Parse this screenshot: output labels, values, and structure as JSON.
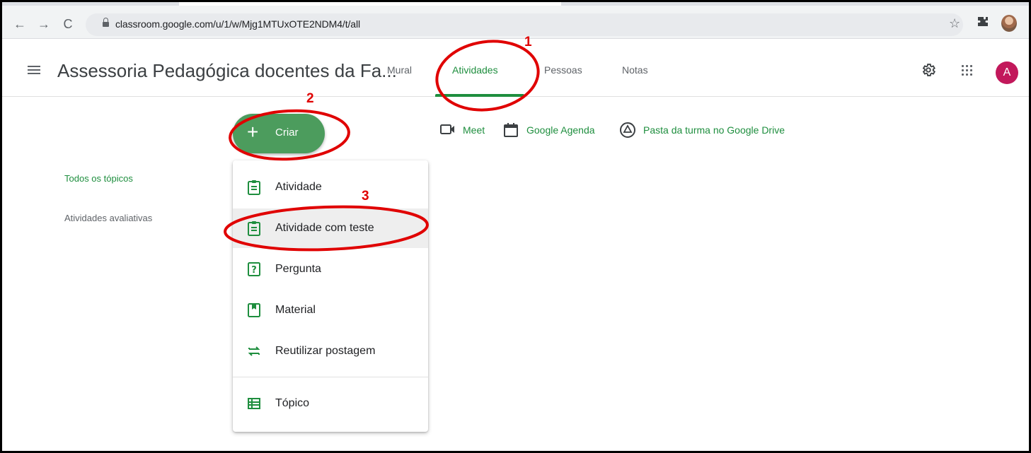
{
  "browser": {
    "url": "classroom.google.com/u/1/w/Mjg1MTUxOTE2NDM4/t/all",
    "back_icon": "arrow-left-icon",
    "forward_icon": "arrow-right-icon",
    "reload_icon": "reload-icon",
    "bookmark_icon": "star-icon",
    "extensions_icon": "puzzle-icon"
  },
  "header": {
    "class_title": "Assessoria Pedagógica docentes da Fa...",
    "tabs": [
      {
        "label": "Mural",
        "active": false
      },
      {
        "label": "Atividades",
        "active": true
      },
      {
        "label": "Pessoas",
        "active": false
      },
      {
        "label": "Notas",
        "active": false
      }
    ],
    "avatar_letter": "A",
    "avatar_color": "#c2185b"
  },
  "create": {
    "plus": "+",
    "label": "Criar",
    "color": "#4c9c5d"
  },
  "links": {
    "meet": "Meet",
    "calendar": "Google Agenda",
    "drive": "Pasta da turma no Google Drive"
  },
  "topics": {
    "all": "Todos os tópicos",
    "graded": "Atividades avaliativas"
  },
  "menu": {
    "items": [
      {
        "label": "Atividade",
        "icon": "assignment-icon"
      },
      {
        "label": "Atividade com teste",
        "icon": "quiz-assignment-icon"
      },
      {
        "label": "Pergunta",
        "icon": "question-icon"
      },
      {
        "label": "Material",
        "icon": "material-icon"
      },
      {
        "label": "Reutilizar postagem",
        "icon": "reuse-post-icon"
      },
      {
        "label": "Tópico",
        "icon": "topic-icon"
      }
    ]
  },
  "annotations": {
    "step1": "1",
    "step2": "2",
    "step3": "3",
    "color": "#e00000"
  },
  "accent_color": "#1e8e3e"
}
